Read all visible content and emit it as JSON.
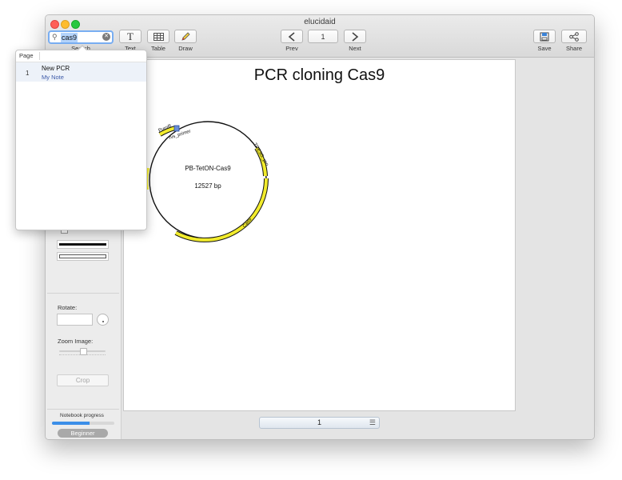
{
  "window": {
    "title": "elucidaid"
  },
  "toolbar": {
    "search_value": "cas9",
    "search_label": "Search",
    "text_label": "Text",
    "table_label": "Table",
    "draw_label": "Draw",
    "prev_label": "Prev",
    "page_number": "1",
    "next_label": "Next",
    "save_label": "Save",
    "share_label": "Share"
  },
  "search_results": {
    "header": "Page",
    "items": [
      {
        "page": "1",
        "title": "New PCR",
        "note": "My Note"
      }
    ]
  },
  "page": {
    "title": "PCR cloning Cas9",
    "plasmid": {
      "name": "PB-TetON-Cas9",
      "size": "12527 bp",
      "features": [
        {
          "label": "PuroR",
          "color": "#f2ec2c"
        },
        {
          "label": "rvs_primer",
          "color": "#6b8fd6"
        },
        {
          "label": "TRE3G_pro",
          "color": "#f2ec2c"
        },
        {
          "label": "Cas9",
          "color": "#f2ec2c"
        }
      ]
    }
  },
  "sidebar": {
    "rotate_label": "Rotate:",
    "zoom_label": "Zoom Image:",
    "crop_label": "Crop",
    "progress_label": "Notebook progress",
    "progress_fraction": 0.6,
    "level_label": "Beginner"
  },
  "pager": {
    "value": "1"
  },
  "colors": {
    "accent": "#79aef2",
    "feature": "#f2ec2c",
    "primer": "#6b8fd6"
  }
}
